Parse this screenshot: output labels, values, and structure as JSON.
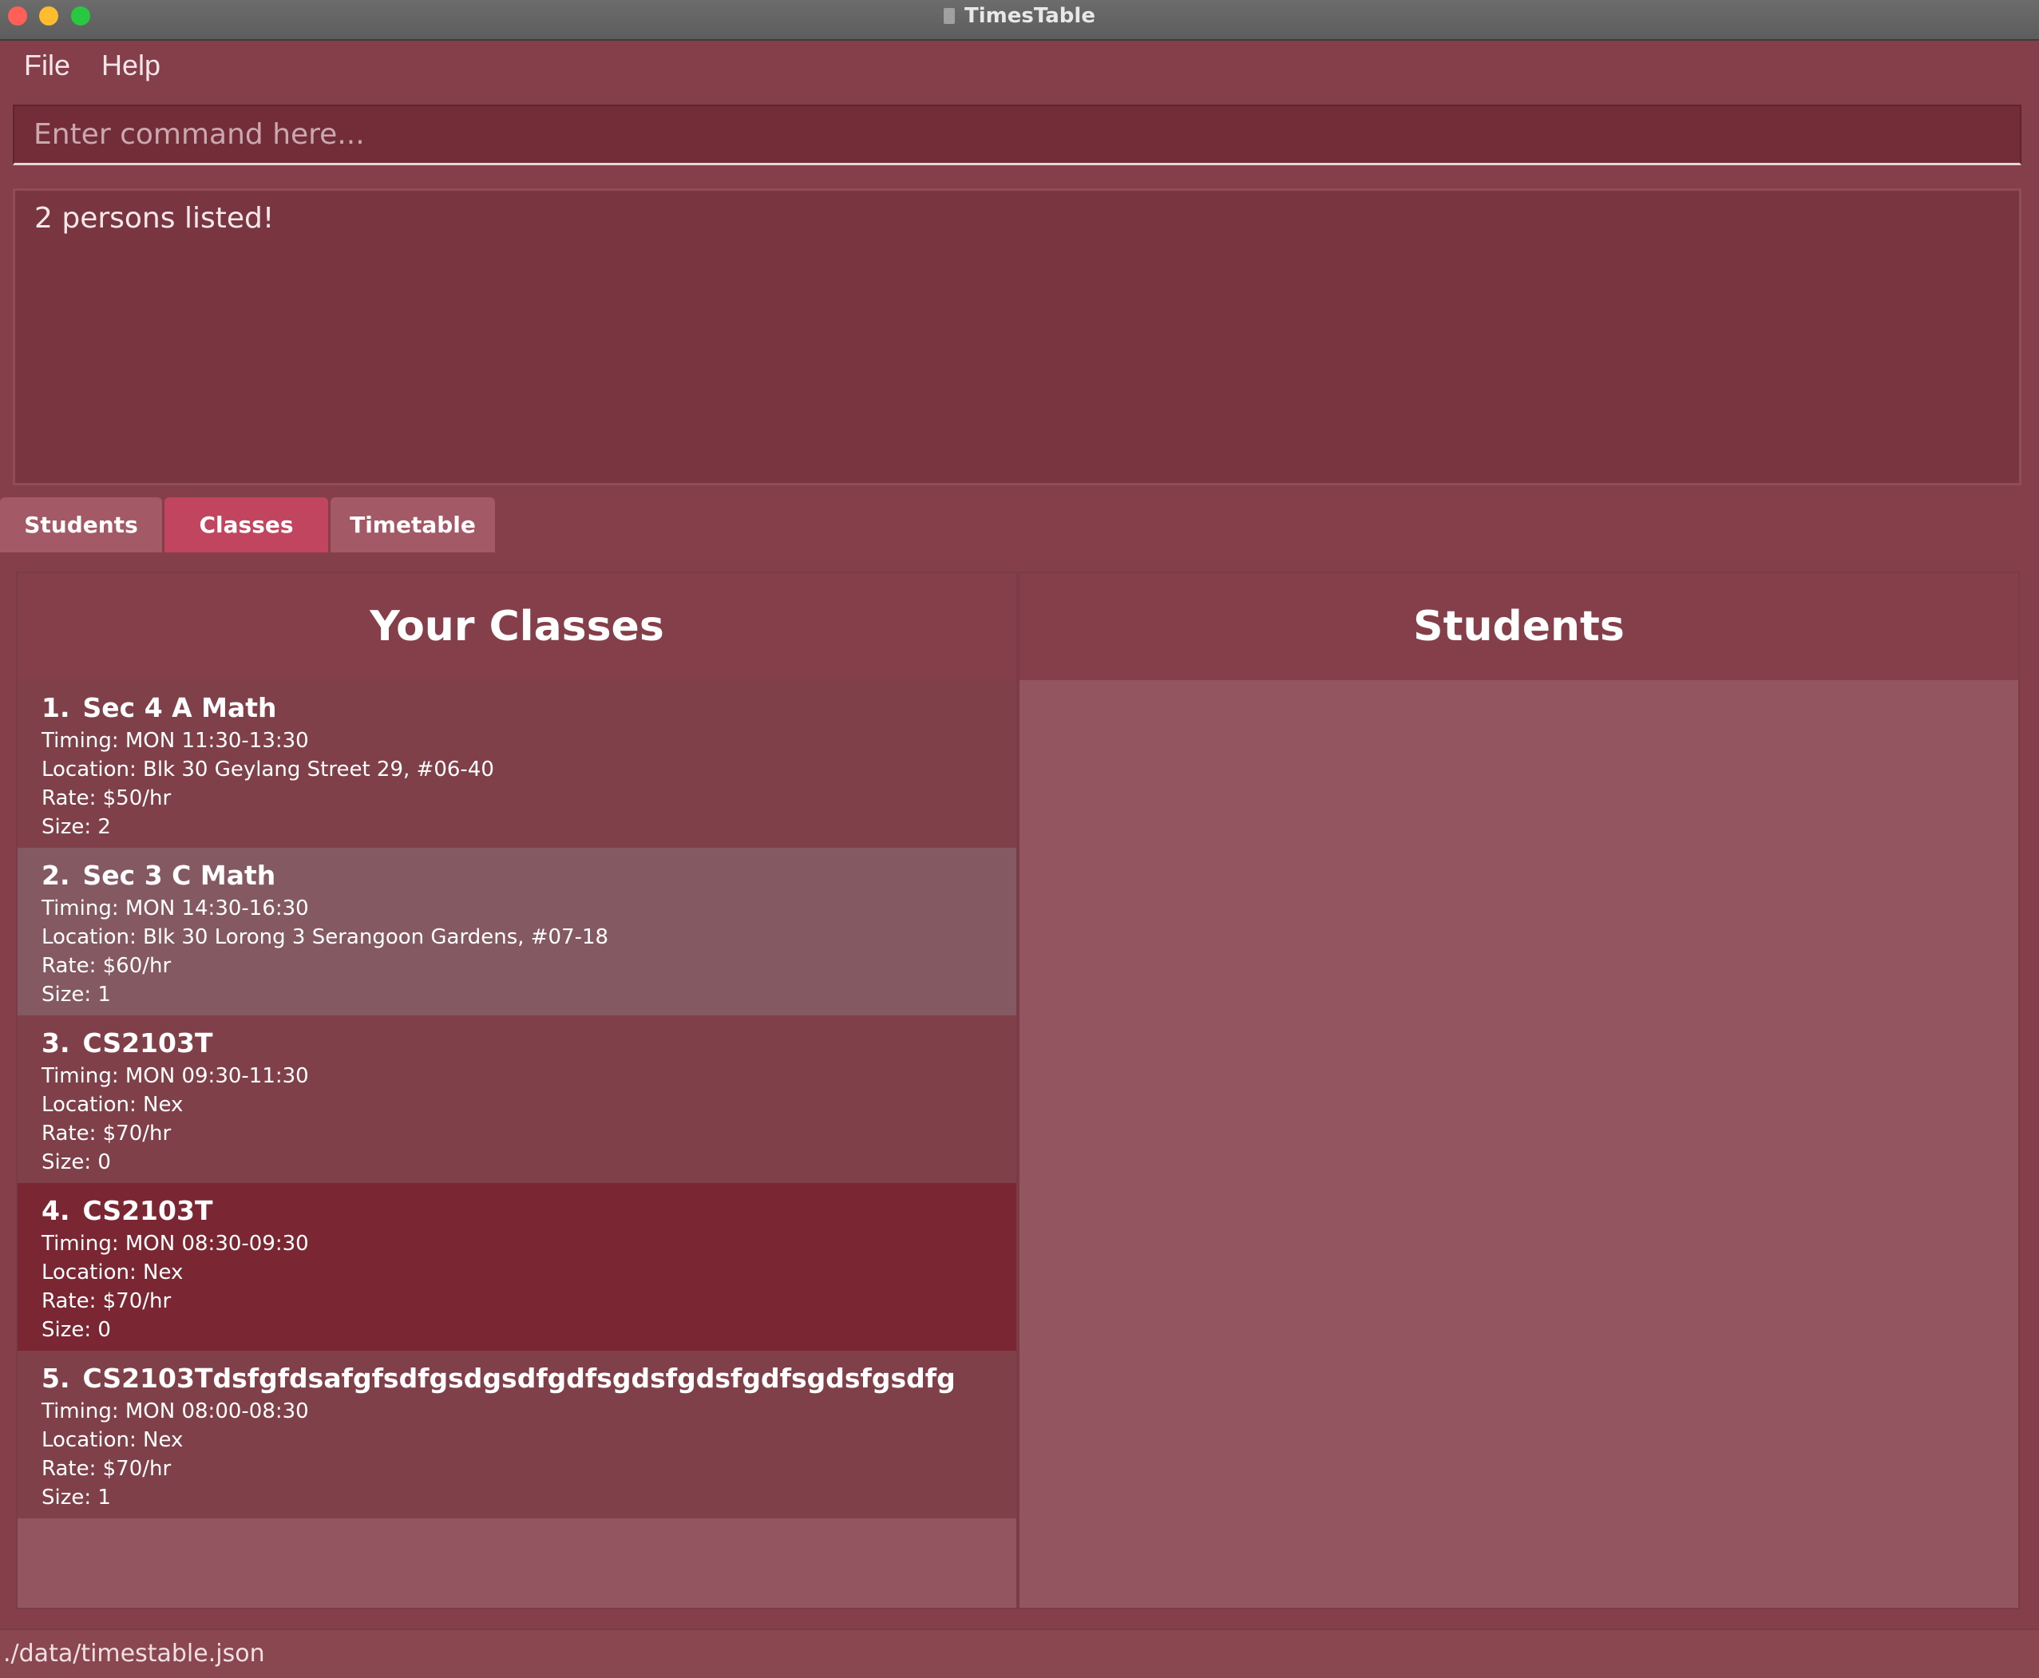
{
  "window": {
    "title": "TimesTable"
  },
  "menu": {
    "file": "File",
    "help": "Help"
  },
  "command": {
    "placeholder": "Enter command here...",
    "value": ""
  },
  "result": {
    "message": "2 persons listed!"
  },
  "tabs": [
    {
      "label": "Students",
      "active": false
    },
    {
      "label": "Classes",
      "active": true
    },
    {
      "label": "Timetable",
      "active": false
    }
  ],
  "classes_panel": {
    "title": "Your Classes",
    "items": [
      {
        "index": "1.",
        "name": "Sec 4 A Math",
        "timing": "Timing: MON 11:30-13:30",
        "location": "Location: Blk 30 Geylang Street 29, #06-40",
        "rate": "Rate: $50/hr",
        "size": "Size: 2"
      },
      {
        "index": "2.",
        "name": "Sec 3 C Math",
        "timing": "Timing: MON 14:30-16:30",
        "location": "Location: Blk 30 Lorong 3 Serangoon Gardens, #07-18",
        "rate": "Rate: $60/hr",
        "size": "Size: 1"
      },
      {
        "index": "3.",
        "name": "CS2103T",
        "timing": "Timing: MON 09:30-11:30",
        "location": "Location: Nex",
        "rate": "Rate: $70/hr",
        "size": "Size: 0"
      },
      {
        "index": "4.",
        "name": "CS2103T",
        "timing": "Timing: MON 08:30-09:30",
        "location": "Location: Nex",
        "rate": "Rate: $70/hr",
        "size": "Size: 0"
      },
      {
        "index": "5.",
        "name": "CS2103Tdsfgfdsafgfsdfgsdgsdfgdfsgdsfgdsfgdfsgdsfgsdfg",
        "timing": "Timing: MON 08:00-08:30",
        "location": "Location: Nex",
        "rate": "Rate: $70/hr",
        "size": "Size: 1"
      }
    ]
  },
  "students_panel": {
    "title": "Students"
  },
  "status": {
    "path": "./data/timestable.json"
  }
}
